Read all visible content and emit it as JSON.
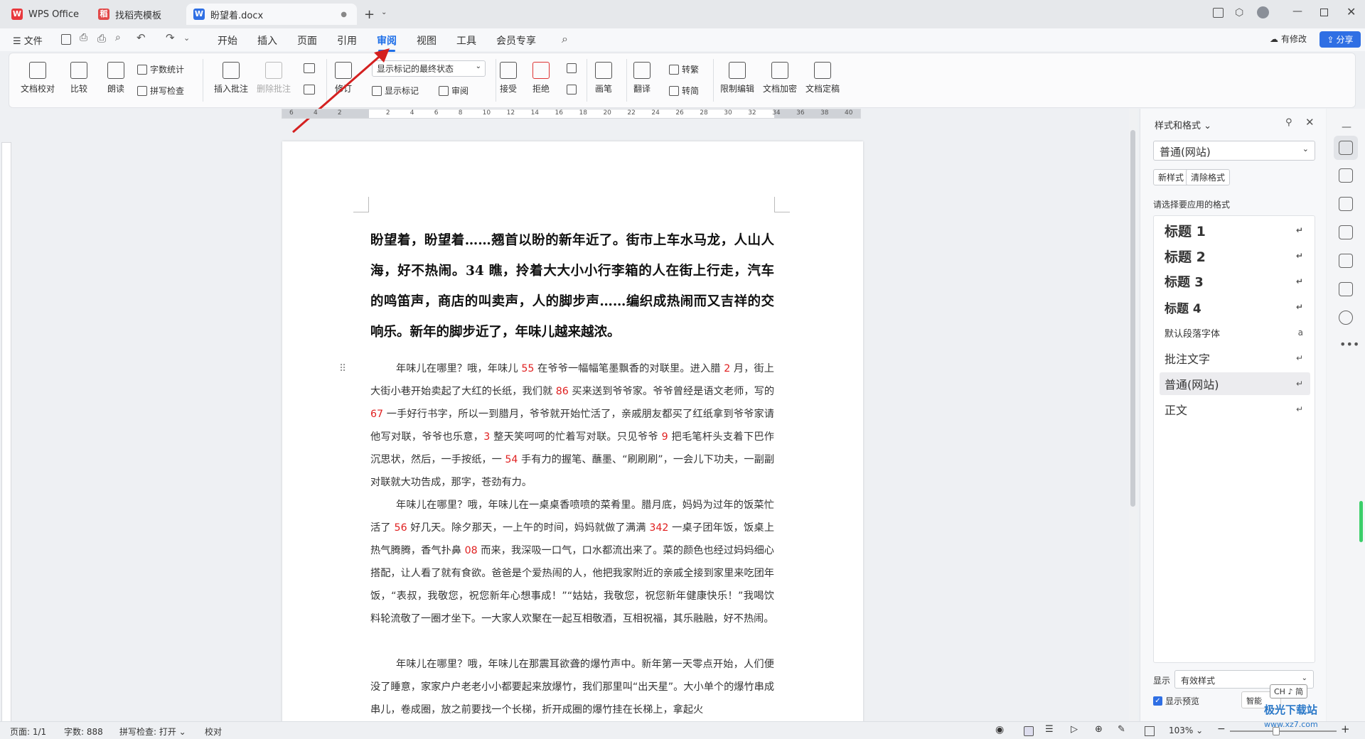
{
  "tabs": [
    {
      "label": "WPS Office"
    },
    {
      "label": "找稻壳模板"
    },
    {
      "label": "盼望着.docx"
    }
  ],
  "window": {
    "edits_label": "有修改",
    "share_label": "分享"
  },
  "menu": {
    "file": "文件",
    "items": [
      "开始",
      "插入",
      "页面",
      "引用",
      "审阅",
      "视图",
      "工具",
      "会员专享"
    ],
    "active_index": 4
  },
  "ribbon": {
    "doc_proof": "文档校对",
    "compare": "比较",
    "read_aloud": "朗读",
    "word_count": "字数统计",
    "spell_check": "拼写检查",
    "insert_comment": "插入批注",
    "delete_comment": "删除批注",
    "track": "修订",
    "markup_select": "显示标记的最终状态",
    "show_markup": "显示标记",
    "review": "审阅",
    "accept": "接受",
    "reject": "拒绝",
    "pen": "画笔",
    "translate": "翻译",
    "to_trad": "转繁",
    "to_simp": "转简",
    "restrict_edit": "限制编辑",
    "encrypt": "文档加密",
    "finalize": "文档定稿"
  },
  "ruler": {
    "ticks": [
      "6",
      "4",
      "2",
      "",
      "2",
      "4",
      "6",
      "8",
      "10",
      "12",
      "14",
      "16",
      "18",
      "20",
      "22",
      "24",
      "26",
      "28",
      "30",
      "32",
      "34",
      "36",
      "38",
      "40"
    ]
  },
  "document": {
    "title_para": "盼望着，盼望着……翘首以盼的新年近了。街市上车水马龙，人山人海，好不热闹。34 瞧，拎着大大小小行李箱的人在街上行走，汽车的鸣笛声，商店的叫卖声，人的脚步声……编织成热闹而又吉祥的交响乐。新年的脚步近了，年味儿越来越浓。",
    "p1": {
      "a": "年味儿在哪里？哦，年味儿 ",
      "n1": "55",
      "b": " 在爷爷一幅幅笔墨飘香的对联里。进入腊 ",
      "n2": "2",
      "c": " 月，街上大街小巷开始卖起了大红的长纸，我们就 ",
      "n3": "86",
      "d": " 买来送到爷爷家。爷爷曾经是语文老师，写的 ",
      "n4": "67",
      "e": " 一手好行书字，所以一到腊月，爷爷就开始忙活了，亲戚朋友都买了红纸拿到爷爷家请他写对联，爷爷也乐意，",
      "n5": "3",
      "f": " 整天笑呵呵的忙着写对联。只见爷爷 ",
      "n6": "9",
      "g": " 把毛笔杆头支着下巴作沉思状，然后，一手按纸，一 ",
      "n7": "54",
      "h": " 手有力的握笔、蘸墨、“刷刷刷”，一会儿下功夫，一副副对联就大功告成，那字，苍劲有力。"
    },
    "p2": {
      "a": "年味儿在哪里？哦，年味儿在一桌桌香喷喷的菜肴里。腊月底，妈妈为过年的饭菜忙活了 ",
      "n1": "56",
      "b": " 好几天。除夕那天，一上午的时间，妈妈就做了满满 ",
      "n2": "342",
      "c": " 一桌子团年饭，饭桌上热气腾腾，香气扑鼻 ",
      "n3": "08",
      "d": " 而来，我深吸一口气，口水都流出来了。菜的颜色也经过妈妈细心搭配，让人看了就有食欲。爸爸是个爱热闹的人，他把我家附近的亲戚全接到家里来吃团年饭，“表叔，我敬您，祝您新年心想事成！”“姑姑，我敬您，祝您新年健康快乐！”我喝饮料轮流敬了一圈才坐下。一大家人欢聚在一起互相敬酒，互相祝福，其乐融融，好不热闹。"
    },
    "p3": "年味儿在哪里？哦，年味儿在那震耳欲聋的爆竹声中。新年第一天零点开始，人们便没了睡意，家家户户老老小小都要起来放爆竹，我们那里叫“出天星”。大小单个的爆竹串成串儿，卷成圈，放之前要找一个长梯，折开成圈的爆竹挂在长梯上，拿起火"
  },
  "panel": {
    "title": "样式和格式",
    "current_style": "普通(网站)",
    "new_style": "新样式",
    "clear_format": "清除格式",
    "choose_label": "请选择要应用的格式",
    "styles": [
      {
        "name": "标题  1"
      },
      {
        "name": "标题  2"
      },
      {
        "name": "标题  3"
      },
      {
        "name": "标题 4"
      },
      {
        "name": "默认段落字体"
      },
      {
        "name": "批注文字"
      },
      {
        "name": "普通(网站)"
      },
      {
        "name": "正文"
      }
    ],
    "show_label": "显示",
    "show_value": "有效样式",
    "preview_label": "显示预览",
    "smart_label": "智能",
    "ime": "CH ♪ 简"
  },
  "status": {
    "page": "页面: 1/1",
    "words": "字数: 888",
    "spell": "拼写检查: 打开",
    "proof": "校对",
    "zoom": "103%",
    "watermark": "极光下载站",
    "watermark_url": "www.xz7.com"
  }
}
